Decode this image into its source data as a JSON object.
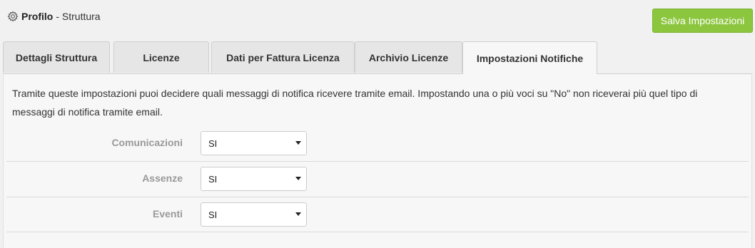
{
  "header": {
    "title_bold": "Profilo",
    "title_rest": "- Struttura",
    "icon": "gear-icon"
  },
  "toolbar": {
    "save_label": "Salva Impostazioni",
    "save_color": "#8cc63f"
  },
  "tabs": [
    {
      "label": "Dettagli Struttura",
      "active": false
    },
    {
      "label": "Licenze",
      "active": false
    },
    {
      "label": "Dati per Fattura Licenza",
      "active": false
    },
    {
      "label": "Archivio Licenze",
      "active": false
    },
    {
      "label": "Impostazioni Notifiche",
      "active": true
    }
  ],
  "main": {
    "description": "Tramite queste impostazioni puoi decidere quali messaggi di notifica ricevere tramite email. Impostando una o più voci su \"No\" non riceverai più quel tipo di messaggi di notifica tramite email.",
    "settings": [
      {
        "label": "Comunicazioni",
        "value": "SI"
      },
      {
        "label": "Assenze",
        "value": "SI"
      },
      {
        "label": "Eventi",
        "value": "SI"
      }
    ]
  }
}
